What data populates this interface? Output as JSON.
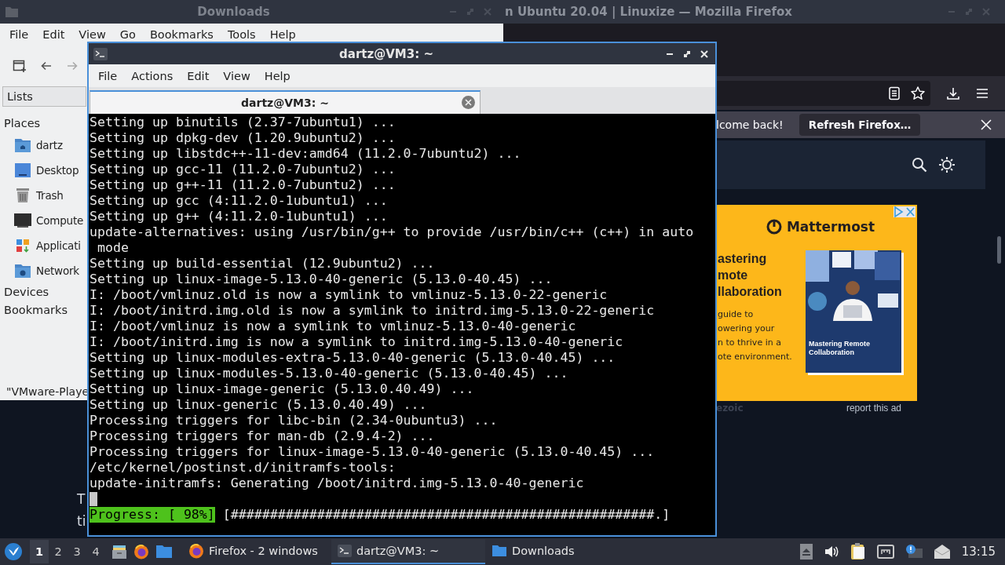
{
  "firefox_window": {
    "title": "n Ubuntu 20.04 | Linuxize — Mozilla Firefox",
    "notification": {
      "message": "lcome back!",
      "button": "Refresh Firefox…"
    },
    "page_fragments": [
      "T",
      "ti"
    ],
    "ad": {
      "brand": "Mattermost",
      "headline": [
        "astering",
        "mote",
        "llaboration"
      ],
      "body": [
        "guide to",
        "owering your",
        "n to thrive in a",
        "ote environment."
      ],
      "cover_title": "Mastering Remote Collaboration",
      "network": "ezoic",
      "report_link": "report this ad"
    }
  },
  "file_manager": {
    "title": "Downloads",
    "menu": [
      "File",
      "Edit",
      "View",
      "Go",
      "Bookmarks",
      "Tools",
      "Help"
    ],
    "side_tab": "Lists",
    "places": {
      "label": "Places",
      "items": [
        {
          "label": "dartz",
          "kind": "home"
        },
        {
          "label": "Desktop",
          "kind": "desktop"
        },
        {
          "label": "Trash",
          "kind": "trash"
        },
        {
          "label": "Compute",
          "kind": "computer"
        },
        {
          "label": "Applicati",
          "kind": "applications"
        },
        {
          "label": "Network",
          "kind": "network"
        }
      ]
    },
    "other_sections": [
      "Devices",
      "Bookmarks"
    ],
    "status": "\"VMware-Playe"
  },
  "terminal": {
    "title": "dartz@VM3: ~",
    "menu": [
      "File",
      "Actions",
      "Edit",
      "View",
      "Help"
    ],
    "tab": {
      "label": "dartz@VM3: ~",
      "selected": true
    },
    "lines": [
      "Setting up binutils (2.37-7ubuntu1) ...",
      "Setting up dpkg-dev (1.20.9ubuntu2) ...",
      "Setting up libstdc++-11-dev:amd64 (11.2.0-7ubuntu2) ...",
      "Setting up gcc-11 (11.2.0-7ubuntu2) ...",
      "Setting up g++-11 (11.2.0-7ubuntu2) ...",
      "Setting up gcc (4:11.2.0-1ubuntu1) ...",
      "Setting up g++ (4:11.2.0-1ubuntu1) ...",
      "update-alternatives: using /usr/bin/g++ to provide /usr/bin/c++ (c++) in auto",
      " mode",
      "Setting up build-essential (12.9ubuntu2) ...",
      "Setting up linux-image-5.13.0-40-generic (5.13.0-40.45) ...",
      "I: /boot/vmlinuz.old is now a symlink to vmlinuz-5.13.0-22-generic",
      "I: /boot/initrd.img.old is now a symlink to initrd.img-5.13.0-22-generic",
      "I: /boot/vmlinuz is now a symlink to vmlinuz-5.13.0-40-generic",
      "I: /boot/initrd.img is now a symlink to initrd.img-5.13.0-40-generic",
      "Setting up linux-modules-extra-5.13.0-40-generic (5.13.0-40.45) ...",
      "Setting up linux-modules-5.13.0-40-generic (5.13.0-40.45) ...",
      "Setting up linux-image-generic (5.13.0.40.49) ...",
      "Setting up linux-generic (5.13.0.40.49) ...",
      "Processing triggers for libc-bin (2.34-0ubuntu3) ...",
      "Processing triggers for man-db (2.9.4-2) ...",
      "Processing triggers for linux-image-5.13.0-40-generic (5.13.0-40.45) ...",
      "/etc/kernel/postinst.d/initramfs-tools:",
      "update-initramfs: Generating /boot/initrd.img-5.13.0-40-generic"
    ],
    "progress": {
      "label": "Progress: [ 98%]",
      "bar": "[######################################################.]"
    }
  },
  "taskbar": {
    "workspaces": [
      {
        "label": "1",
        "selected": true
      },
      {
        "label": "2",
        "selected": false
      },
      {
        "label": "3",
        "selected": false
      },
      {
        "label": "4",
        "selected": false
      }
    ],
    "tasks": [
      {
        "label": "Firefox - 2 windows",
        "kind": "firefox",
        "selected": false
      },
      {
        "label": "dartz@VM3: ~",
        "kind": "terminal",
        "selected": true
      },
      {
        "label": "Downloads",
        "kind": "folder",
        "selected": false
      }
    ],
    "clock": "13:15"
  }
}
